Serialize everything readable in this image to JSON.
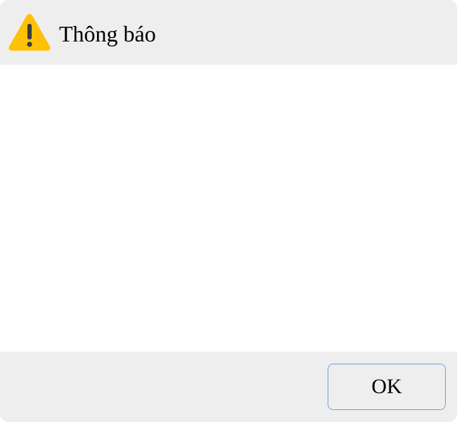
{
  "dialog": {
    "title": "Thông báo",
    "icon": "warning-icon",
    "message": "",
    "ok_label": "OK"
  },
  "colors": {
    "titlebar_background": "#eeeeee",
    "content_background": "#ffffff",
    "warning_icon": "#ffc107",
    "button_border": "#6f9fe0"
  }
}
